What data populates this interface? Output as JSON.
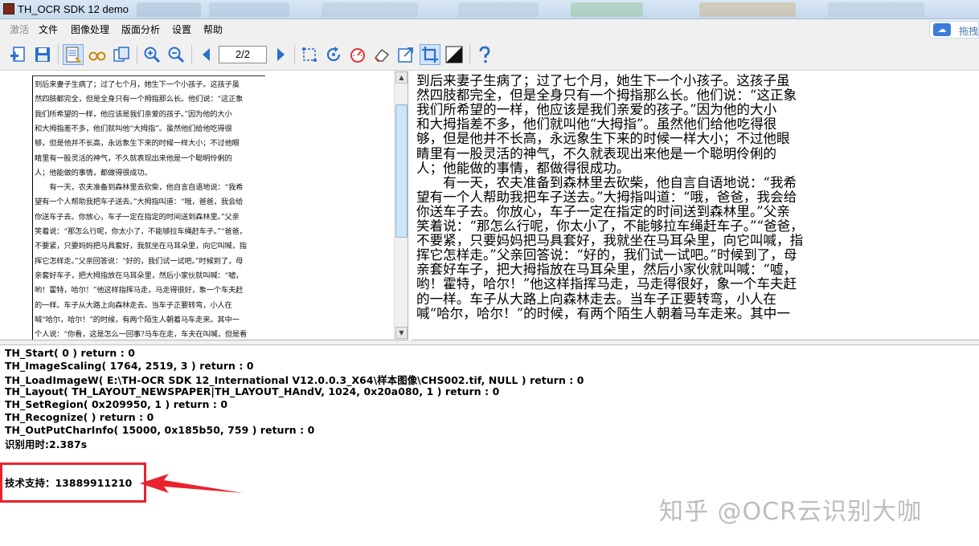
{
  "window": {
    "title": "TH_OCR SDK 12 demo"
  },
  "menu": {
    "items": [
      "激活",
      "文件",
      "图像处理",
      "版面分析",
      "设置",
      "帮助"
    ],
    "share_label": "拖拽"
  },
  "toolbar": {
    "page_indicator": "2/2",
    "icons": [
      "add-page-icon",
      "save-icon",
      "scan-page-icon",
      "glasses-icon",
      "copy-icon",
      "zoom-in-icon",
      "zoom-out-icon",
      "prev-page-icon",
      "next-page-icon",
      "crop-icon",
      "rotate-icon",
      "deskew-icon",
      "erase-icon",
      "resize-icon",
      "select-region-icon",
      "binarize-icon",
      "help-icon"
    ]
  },
  "scan_page": {
    "lines": [
      "到后来妻子生病了；过了七个月，她生下一个小孩子。这孩子虽",
      "然四肢都完全，但是全身只有一个拇指那么长。他们说：“这正象",
      "我们所希望的一样，他应该是我们亲爱的孩子。”因为他的大小",
      "和大拇指差不多，他们就叫他“大拇指”。虽然他们给他吃得很",
      "够，但是他并不长高，永远象生下来的时候一样大小；不过他眼",
      "睛里有一股灵活的神气，不久就表现出来他是一个聪明伶俐的",
      "人；他能做的事情，都做得很成功。",
      "　　有一天，农夫准备到森林里去砍柴，他自言自语地说：“我希",
      "望有一个人帮助我把车子送去。”大拇指叫道：“哦，爸爸，我会给",
      "你送车子去。你放心，车子一定在指定的时间送到森林里。”父亲",
      "笑着说：“那怎么行呢，你太小了，不能够拉车绳赶车子。”“爸爸，",
      "不要紧，只要妈妈把马具套好，我就坐在马耳朵里，向它叫喊，指",
      "挥它怎样走。”父亲回答说：“好的，我们试一试吧。”时候到了，母",
      "亲套好车子，把大拇指放在马耳朵里，然后小家伙就叫喊：“嘘，",
      "哟！霍特，哈尔！”他这样指挥马走，马走得很好，象一个车夫赶",
      "的一样。车子从大路上向森林走去。当车子正要转弯，小人在",
      "喊“哈尔，哈尔！”的时候，有两个陌生人朝着马车走来。其中一",
      "个人说：“你看，这是怎么一回事?马车在走，车夫在叫喊，但是看"
    ]
  },
  "ocr_result": {
    "lines": [
      "到后来妻子生病了；过了七个月，她生下一个小孩子。这孩子虽",
      "然四肢都完全，但是全身只有一个拇指那么长。他们说：“这正象",
      "我们所希望的一样，他应该是我们亲爱的孩子。”因为他的大小",
      "和大拇指差不多，他们就叫他“大拇指”。虽然他们给他吃得很",
      "够，但是他并不长高，永远象生下来的时候一样大小；不过他眼",
      "睛里有一股灵活的神气，不久就表现出来他是一个聪明伶俐的",
      "人；他能做的事情，都做得很成功。",
      "　　有一天，农夫准备到森林里去砍柴，他自言自语地说：“我希",
      "望有一个人帮助我把车子送去。”大拇指叫道：“哦，爸爸，我会给",
      "你送车子去。你放心，车子一定在指定的时间送到森林里。”父亲",
      "笑着说：“那怎么行呢，你太小了，不能够拉车绳赶车子。”“爸爸，",
      "不要紧，只要妈妈把马具套好，我就坐在马耳朵里，向它叫喊，指",
      "挥它怎样走。”父亲回答说：“好的，我们试一试吧。”时候到了，母",
      "亲套好车子，把大拇指放在马耳朵里，然后小家伙就叫喊：“嘘，",
      "哟！霍特，哈尔！”他这样指挥马走，马走得很好，象一个车夫赶",
      "的一样。车子从大路上向森林走去。当车子正要转弯，小人在",
      "喊“哈尔，哈尔！”的时候，有两个陌生人朝着马车走来。其中一"
    ]
  },
  "log": {
    "lines": [
      "TH_Start( 0 ) return : 0",
      "TH_ImageScaling( 1764, 2519, 3 ) return : 0",
      "TH_LoadImageW( E:\\TH-OCR SDK 12_International V12.0.0.3_X64\\样本图像\\CHS002.tif,  NULL ) return : 0",
      "TH_Layout( TH_LAYOUT_NEWSPAPER|TH_LAYOUT_HAndV, 1024, 0x20a080, 1 ) return : 0",
      "TH_SetRegion( 0x209950, 1 ) return : 0",
      "TH_Recognize( ) return : 0",
      "TH_OutPutCharInfo( 15000, 0x185b50, 759 ) return : 0",
      "识别用时:2.387s"
    ],
    "support": "技术支持：13889911210"
  },
  "watermark": "知乎 @OCR云识别大咖",
  "colors": {
    "highlight_box": "#e8232e",
    "toolbar_icon_blue": "#2a6fc9"
  }
}
